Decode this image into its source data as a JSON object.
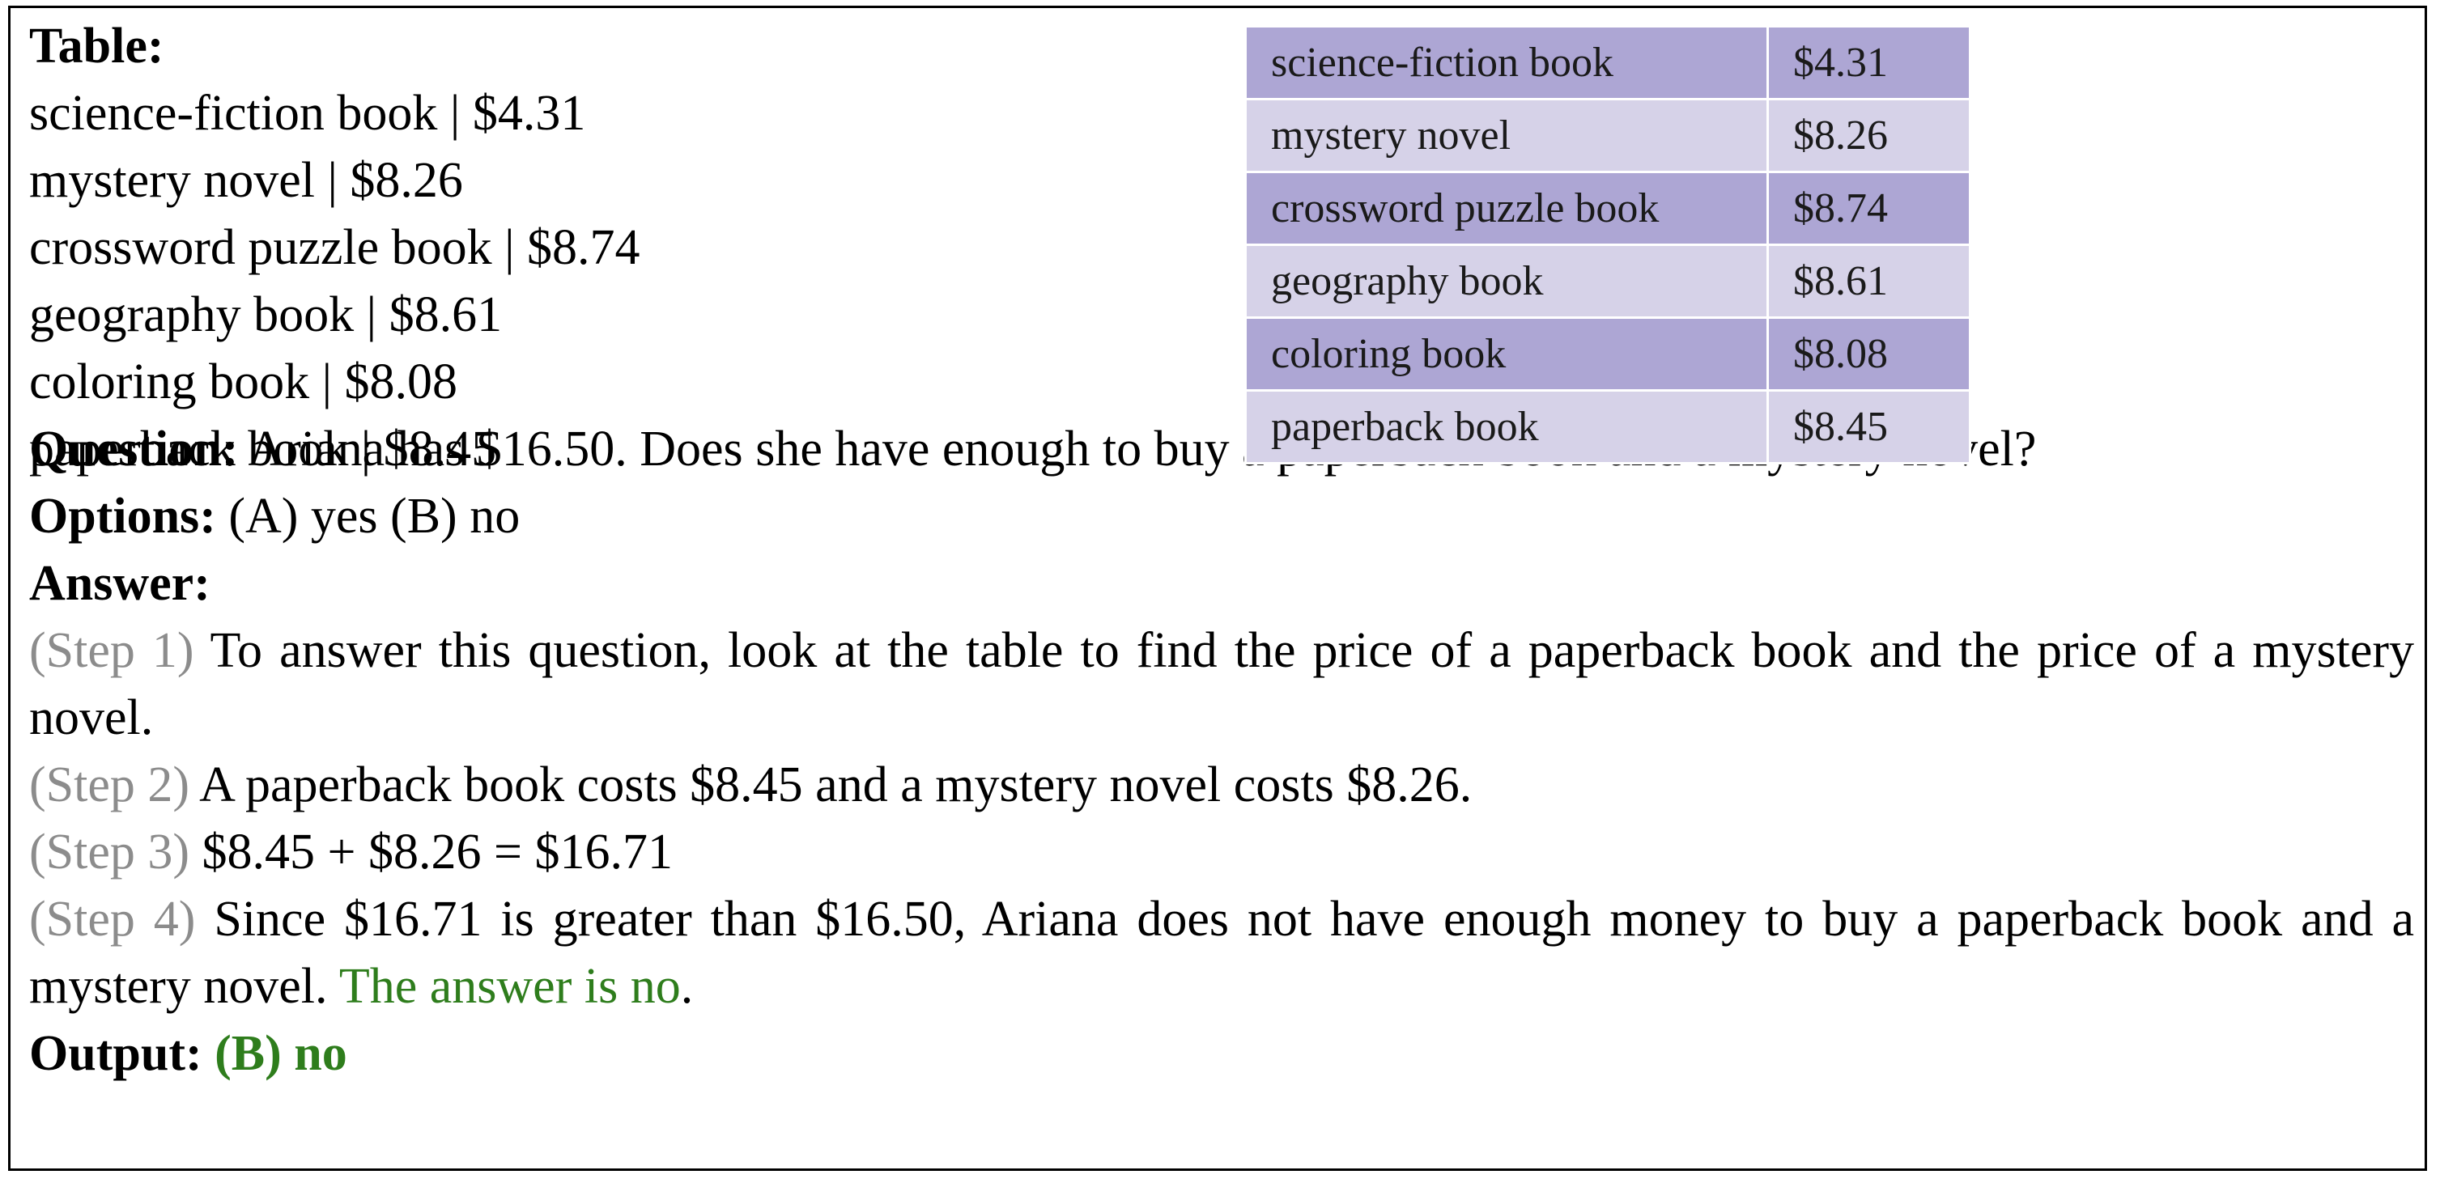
{
  "table_label": "Table:",
  "text_table_rows": [
    "science-fiction book | $4.31",
    "mystery novel | $8.26",
    "crossword puzzle book | $8.74",
    "geography book | $8.61",
    "coloring book | $8.08",
    "paperback book | $8.45"
  ],
  "price_table": {
    "rows": [
      {
        "item": "science-fiction book",
        "price": "$4.31"
      },
      {
        "item": "mystery novel",
        "price": "$8.26"
      },
      {
        "item": "crossword puzzle book",
        "price": "$8.74"
      },
      {
        "item": "geography book",
        "price": "$8.61"
      },
      {
        "item": "coloring book",
        "price": "$8.08"
      },
      {
        "item": "paperback book",
        "price": "$8.45"
      }
    ],
    "colors": {
      "dark_row": "#ada6d4",
      "light_row": "#d6d2e8"
    }
  },
  "question": {
    "label": "Question:",
    "text": " Ariana has $16.50. Does she have enough to buy a paperback book and a mystery novel?"
  },
  "options": {
    "label": "Options:",
    "text": " (A) yes (B) no"
  },
  "answer_label": "Answer:",
  "steps": [
    {
      "tag": "(Step 1)",
      "text": " To answer this question, look at the table to find the price of a paperback book and the price of a mystery novel."
    },
    {
      "tag": "(Step 2)",
      "text": " A paperback book costs $8.45 and a mystery novel costs $8.26."
    },
    {
      "tag": "(Step 3)",
      "text": " $8.45 + $8.26 = $16.71"
    },
    {
      "tag": "(Step 4)",
      "text": " Since $16.71 is greater than $16.50, Ariana does not have enough money to buy a paperback book and a mystery novel. ",
      "conclusion": "The answer is no",
      "end": "."
    }
  ],
  "output": {
    "label": "Output:",
    "value": "(B) no"
  },
  "colors": {
    "step_tag": "#8c8c8c",
    "highlight_green": "#2e7d1c"
  }
}
